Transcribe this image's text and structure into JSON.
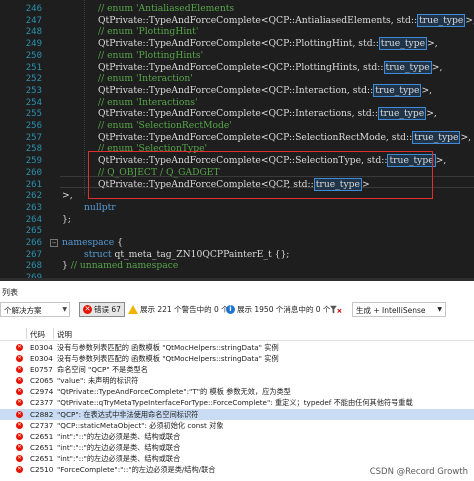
{
  "editor": {
    "lines": [
      {
        "num": "246",
        "html_parts": [
          {
            "c": "t-green",
            "t": "// enum 'AntialiasedElements"
          }
        ]
      },
      {
        "num": "247",
        "html_parts": [
          {
            "c": "t-fn",
            "t": "QtPrivate::TypeAndForceComplete<QCP::AntialiasedElements, std::"
          },
          {
            "c": "t-box",
            "t": "true_type"
          },
          {
            "c": "t-fn",
            "t": ">,"
          }
        ]
      },
      {
        "num": "248",
        "html_parts": [
          {
            "c": "t-green",
            "t": "// enum 'PlottingHint'"
          }
        ]
      },
      {
        "num": "249",
        "html_parts": [
          {
            "c": "t-fn",
            "t": "QtPrivate::TypeAndForceComplete<QCP::PlottingHint, std::"
          },
          {
            "c": "t-box",
            "t": "true_type"
          },
          {
            "c": "t-fn",
            "t": ">,"
          }
        ]
      },
      {
        "num": "250",
        "html_parts": [
          {
            "c": "t-green",
            "t": "// enum 'PlottingHints'"
          }
        ]
      },
      {
        "num": "251",
        "html_parts": [
          {
            "c": "t-fn",
            "t": "QtPrivate::TypeAndForceComplete<QCP::PlottingHints, std::"
          },
          {
            "c": "t-box",
            "t": "true_type"
          },
          {
            "c": "t-fn",
            "t": ">,"
          }
        ]
      },
      {
        "num": "252",
        "html_parts": [
          {
            "c": "t-green",
            "t": "// enum 'Interaction'"
          }
        ]
      },
      {
        "num": "253",
        "html_parts": [
          {
            "c": "t-fn",
            "t": "QtPrivate::TypeAndForceComplete<QCP::Interaction, std::"
          },
          {
            "c": "t-box",
            "t": "true_type"
          },
          {
            "c": "t-fn",
            "t": ">,"
          }
        ]
      },
      {
        "num": "254",
        "html_parts": [
          {
            "c": "t-green",
            "t": "// enum 'Interactions'"
          }
        ]
      },
      {
        "num": "255",
        "html_parts": [
          {
            "c": "t-fn",
            "t": "QtPrivate::TypeAndForceComplete<QCP::Interactions, std::"
          },
          {
            "c": "t-box",
            "t": "true_type"
          },
          {
            "c": "t-fn",
            "t": ">,"
          }
        ]
      },
      {
        "num": "256",
        "html_parts": [
          {
            "c": "t-green",
            "t": "// enum 'SelectionRectMode'"
          }
        ]
      },
      {
        "num": "257",
        "html_parts": [
          {
            "c": "t-fn",
            "t": "QtPrivate::TypeAndForceComplete<QCP::SelectionRectMode, std::"
          },
          {
            "c": "t-box",
            "t": "true_type"
          },
          {
            "c": "t-fn",
            "t": ">,"
          }
        ]
      },
      {
        "num": "258",
        "html_parts": [
          {
            "c": "t-green",
            "t": "// enum 'SelectionType'"
          }
        ]
      },
      {
        "num": "259",
        "html_parts": [
          {
            "c": "t-fn",
            "t": "QtPrivate::TypeAndForceComplete<QCP::SelectionType, std::"
          },
          {
            "c": "t-box",
            "t": "true_type"
          },
          {
            "c": "t-fn",
            "t": ">,"
          }
        ]
      },
      {
        "num": "260",
        "html_parts": [
          {
            "c": "t-green",
            "t": "// Q_OBJECT / Q_GADGET"
          }
        ]
      },
      {
        "num": "261",
        "html_parts": [
          {
            "c": "t-fn",
            "t": "QtPrivate::TypeAndForceComplete<QCP, std::"
          },
          {
            "c": "t-box",
            "t": "true_type"
          },
          {
            "c": "t-fn",
            "t": ">"
          }
        ]
      },
      {
        "num": "262",
        "html_parts": [
          {
            "c": "t-fn",
            "t": ">,"
          }
        ]
      },
      {
        "num": "263",
        "html_parts": [
          {
            "c": "t-kw",
            "t": "nullptr"
          }
        ]
      },
      {
        "num": "264",
        "html_parts": [
          {
            "c": "t-fn",
            "t": "};"
          }
        ]
      },
      {
        "num": "265",
        "html_parts": []
      },
      {
        "num": "266",
        "html_parts": [
          {
            "c": "t-kw",
            "t": "namespace"
          },
          {
            "c": "t-fn",
            "t": " {"
          }
        ]
      },
      {
        "num": "267",
        "html_parts": [
          {
            "c": "t-kw",
            "t": "struct"
          },
          {
            "c": "t-fn",
            "t": " qt_meta_tag_ZN10QCPPainterE_t {};"
          }
        ]
      },
      {
        "num": "268",
        "html_parts": [
          {
            "c": "t-fn",
            "t": "} "
          },
          {
            "c": "t-green",
            "t": "// unnamed namespace"
          }
        ]
      },
      {
        "num": "269",
        "html_parts": []
      }
    ],
    "status_zoom": "%",
    "status_errors": "47",
    "status_warnings": "0"
  },
  "panel": {
    "title": "列表",
    "scope": "个解决方案",
    "filter_errors": "错误 67",
    "filter_warnings": "展示 221 个警告中的 0 个",
    "filter_messages": "展示 1950 个消息中的 0 个",
    "build_source": "生成 + IntelliSense",
    "col_code": "代码",
    "col_desc": "说明",
    "rows": [
      {
        "code": "E0304",
        "desc": "没有与参数列表匹配的 函数模板 \"QtMocHelpers::stringData\" 实例",
        "sel": false
      },
      {
        "code": "E0304",
        "desc": "没有与参数列表匹配的 函数模板 \"QtMocHelpers::stringData\" 实例",
        "sel": false
      },
      {
        "code": "E0757",
        "desc": "命名空间 \"QCP\" 不是类型名",
        "sel": false
      },
      {
        "code": "C2065",
        "desc": "\"value\": 未声明的标识符",
        "sel": false
      },
      {
        "code": "C2974",
        "desc": "\"QtPrivate::TypeAndForceComplete\":\"T\"的 模板 参数无效，应为类型",
        "sel": false
      },
      {
        "code": "C2377",
        "desc": "\"QtPrivate::qTryMetaTypeInterfaceForType::ForceComplete\": 重定义；typedef 不能由任何其他符号重载",
        "sel": false
      },
      {
        "code": "C2882",
        "desc": "\"QCP\": 在表达式中非法使用命名空间标识符",
        "sel": true
      },
      {
        "code": "C2737",
        "desc": "\"QCP::staticMetaObject\": 必须初始化 const 对象",
        "sel": false
      },
      {
        "code": "C2651",
        "desc": "\"int\":\"::\"的左边必须是类、结构或联合",
        "sel": false
      },
      {
        "code": "C2651",
        "desc": "\"int\":\"::\"的左边必须是类、结构或联合",
        "sel": false
      },
      {
        "code": "C2651",
        "desc": "\"int\":\"::\"的左边必须是类、结构或联合",
        "sel": false
      },
      {
        "code": "C2510",
        "desc": "\"ForceComplete\":\"::\"的左边必须是类/结构/联合",
        "sel": false
      }
    ]
  },
  "watermark": "CSDN @Record Growth"
}
